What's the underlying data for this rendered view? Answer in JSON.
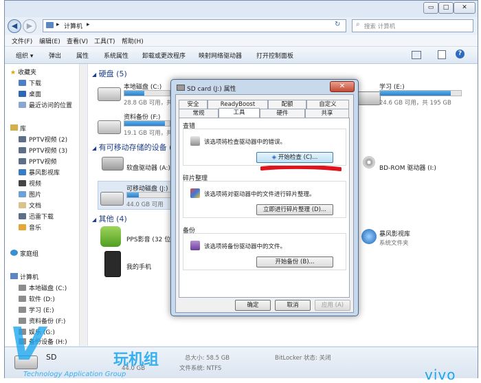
{
  "window": {
    "minimize": "▭",
    "maximize": "□",
    "close": "✕"
  },
  "address": {
    "back": "◀",
    "forward": "▶",
    "path_root": "▸",
    "path": "计算机",
    "path_arrow": "▸",
    "refresh": "↻",
    "search_placeholder": "搜索 计算机"
  },
  "menubar": [
    "文件(F)",
    "编辑(E)",
    "查看(V)",
    "工具(T)",
    "帮助(H)"
  ],
  "toolbar": [
    "组织 ▾",
    "弹出",
    "属性",
    "系统属性",
    "卸载或更改程序",
    "映射网络驱动器",
    "打开控制面板"
  ],
  "nav": {
    "favorites": "收藏夹",
    "fav_items": [
      "下载",
      "桌面",
      "最近访问的位置"
    ],
    "library": "库",
    "lib_items": [
      "PPTV视频 (2)",
      "PPTV视频 (3)",
      "PPTV视频",
      "暴风影视库",
      "视频",
      "图片",
      "文档",
      "迅雷下载",
      "音乐"
    ],
    "homegroup": "家庭组",
    "computer": "计算机",
    "comp_items": [
      "本地磁盘 (C:)",
      "软件 (D:)",
      "学习 (E:)",
      "资料备份 (F:)",
      "娱乐 (G:)",
      "备份设备 (H:)"
    ]
  },
  "content": {
    "hdd_group": "硬盘 (5)",
    "drives": [
      {
        "name": "本地磁盘 (C:)",
        "space": "28.8 GB 可用，共 51.1 GB",
        "used": 0.44
      },
      {
        "name": "资料备份 (F:)",
        "space": "19.1 GB 可用，共 195 GB",
        "used": 0.9
      },
      {
        "name": "学习 (E:)",
        "space": "24.6 GB 可用，共 195 GB",
        "used": 0.87
      }
    ],
    "removable_group": "有可移动存储的设备 (2)",
    "floppy": "软盘驱动器 (A:)",
    "removable": {
      "name": "可移动磁盘 (J:)",
      "space": "44.0 GB 可用",
      "used": 0.25
    },
    "bdrom": "BD-ROM 驱动器 (I:)",
    "other_group": "其他 (4)",
    "pps": "PPS影音 (32 位)",
    "phone": "我的手机",
    "baofeng": "暴风影视库",
    "baofeng_sub": "系统文件夹"
  },
  "details": {
    "drive_name": "SD",
    "drive_sub": "44.0 GB",
    "total": "总大小: 58.5 GB",
    "fs": "文件系统: NTFS",
    "bitlocker": "BitLocker 状态: 关闭"
  },
  "dialog": {
    "title": "SD card (J:) 属性",
    "close": "✕",
    "tabs_row1": [
      "安全",
      "ReadyBoost",
      "配额",
      "自定义"
    ],
    "tabs_row2": [
      "常规",
      "工具",
      "硬件",
      "共享"
    ],
    "check_title": "查错",
    "check_text": "该选项将检查驱动器中的错误。",
    "check_button": "开始检查 (C)...",
    "defrag_title": "碎片整理",
    "defrag_text": "该选项将对驱动器中的文件进行碎片整理。",
    "defrag_button": "立即进行碎片整理 (D)...",
    "backup_title": "备份",
    "backup_text": "该选项将备份驱动器中的文件。",
    "backup_button": "开始备份 (B)...",
    "ok": "确定",
    "cancel": "取消",
    "apply": "应用 (A)"
  },
  "watermark": {
    "text": "玩机组",
    "sub": "Technology Application Group",
    "brand": "vivo"
  },
  "colors": {
    "accent": "#1aa6f0",
    "highlight_stroke": "#e0141c",
    "bar_fill": "#2b7fcc"
  }
}
